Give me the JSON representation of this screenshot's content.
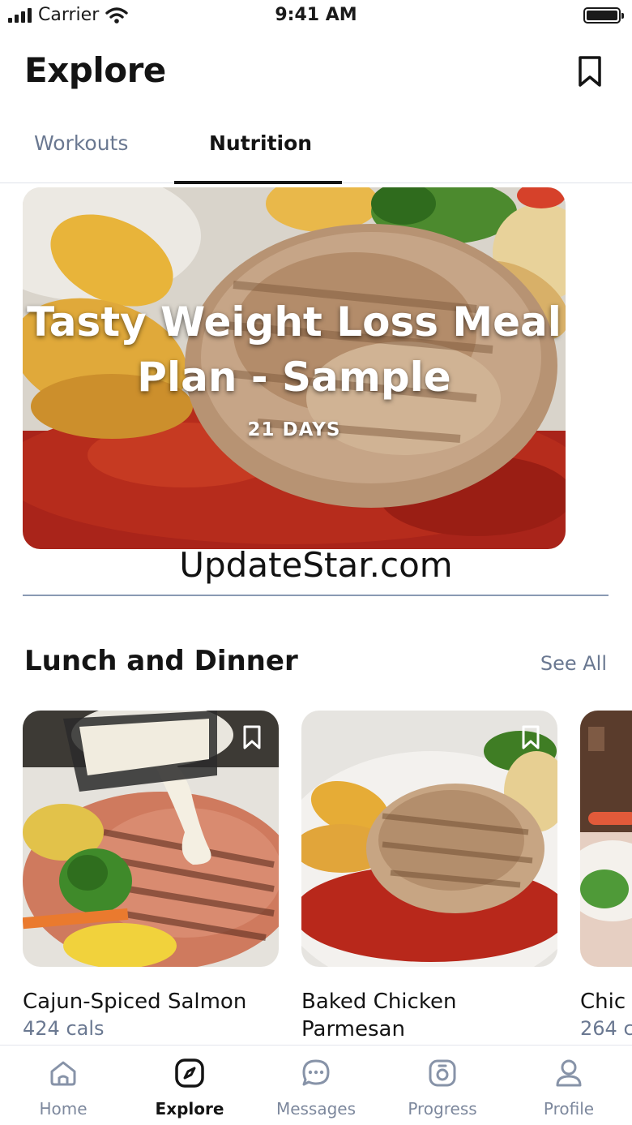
{
  "status_bar": {
    "carrier": "Carrier",
    "time": "9:41 AM"
  },
  "header": {
    "title": "Explore",
    "bookmark_icon": "bookmark-icon"
  },
  "tabs": [
    {
      "label": "Workouts",
      "active": false
    },
    {
      "label": "Nutrition",
      "active": true
    }
  ],
  "featured": {
    "title": "Tasty Weight Loss Meal Plan - Sample",
    "duration": "21  DAYS"
  },
  "watermark": "UpdateStar.com",
  "section": {
    "title": "Lunch and Dinner",
    "see_all": "See All",
    "cards": [
      {
        "name": "Cajun-Spiced Salmon",
        "cals": "424 cals"
      },
      {
        "name": "Baked Chicken Parmesan",
        "cals": ""
      },
      {
        "name": "Chic",
        "cals": "264 c"
      }
    ]
  },
  "nav": [
    {
      "label": "Home",
      "icon": "home-icon",
      "active": false
    },
    {
      "label": "Explore",
      "icon": "compass-icon",
      "active": true
    },
    {
      "label": "Messages",
      "icon": "chat-icon",
      "active": false
    },
    {
      "label": "Progress",
      "icon": "progress-icon",
      "active": false
    },
    {
      "label": "Profile",
      "icon": "profile-icon",
      "active": false
    }
  ],
  "colors": {
    "accent_text": "#141414",
    "muted_text": "#6a7891",
    "divider": "#8a9ab3"
  }
}
